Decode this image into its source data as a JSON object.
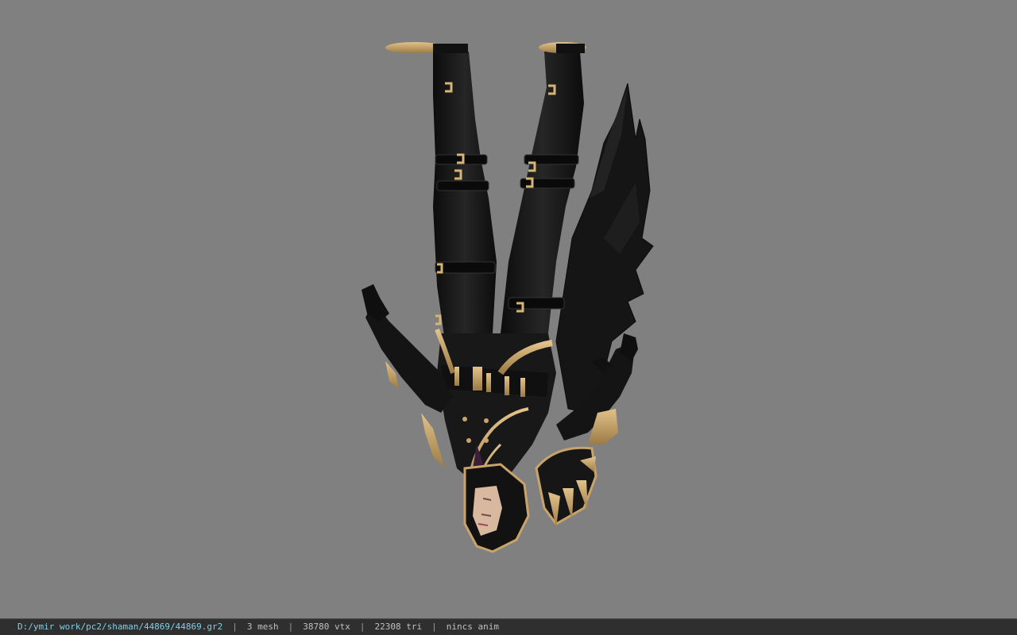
{
  "statusbar": {
    "file_path": "D:/ymir work/pc2/shaman/44869/44869.gr2",
    "separator": "|",
    "mesh_count": "3 mesh",
    "vertex_count": "38780 vtx",
    "triangle_count": "22308 tri",
    "anim_status": "nincs anim"
  },
  "viewport": {
    "background_color": "#808080",
    "model_icon": "character-model-render"
  },
  "colors": {
    "statusbar_bg": "#2f2f2f",
    "path_text": "#7fd0e8",
    "model_black": "#141414",
    "model_gold": "#c9a46a"
  }
}
